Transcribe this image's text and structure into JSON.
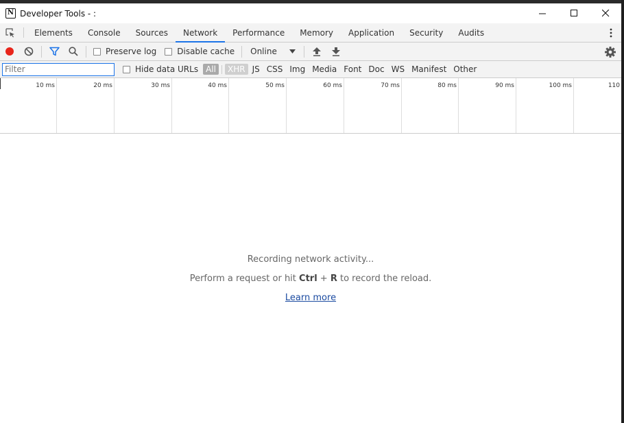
{
  "window": {
    "app_icon": "N",
    "title": "Developer Tools - :",
    "controls": [
      "minimize-icon",
      "maximize-icon",
      "close-icon"
    ]
  },
  "tabs": [
    {
      "label": "Elements"
    },
    {
      "label": "Console"
    },
    {
      "label": "Sources"
    },
    {
      "label": "Network",
      "active": true
    },
    {
      "label": "Performance"
    },
    {
      "label": "Memory"
    },
    {
      "label": "Application"
    },
    {
      "label": "Security"
    },
    {
      "label": "Audits"
    }
  ],
  "toolbar": {
    "preserve_log": "Preserve log",
    "disable_cache": "Disable cache",
    "throttling": "Online",
    "record_color": "#e8251b"
  },
  "filter": {
    "placeholder": "Filter",
    "hide_data_urls": "Hide data URLs",
    "types": [
      "All",
      "XHR",
      "JS",
      "CSS",
      "Img",
      "Media",
      "Font",
      "Doc",
      "WS",
      "Manifest",
      "Other"
    ]
  },
  "timeline": {
    "ticks": [
      "10 ms",
      "20 ms",
      "30 ms",
      "40 ms",
      "50 ms",
      "60 ms",
      "70 ms",
      "80 ms",
      "90 ms",
      "100 ms",
      "110"
    ]
  },
  "empty_state": {
    "line1": "Recording network activity...",
    "line2_pre": "Perform a request or hit",
    "line2_key1": "Ctrl",
    "line2_plus": "+",
    "line2_key2": "R",
    "line2_post": "to record the reload.",
    "learn_more": "Learn more"
  }
}
